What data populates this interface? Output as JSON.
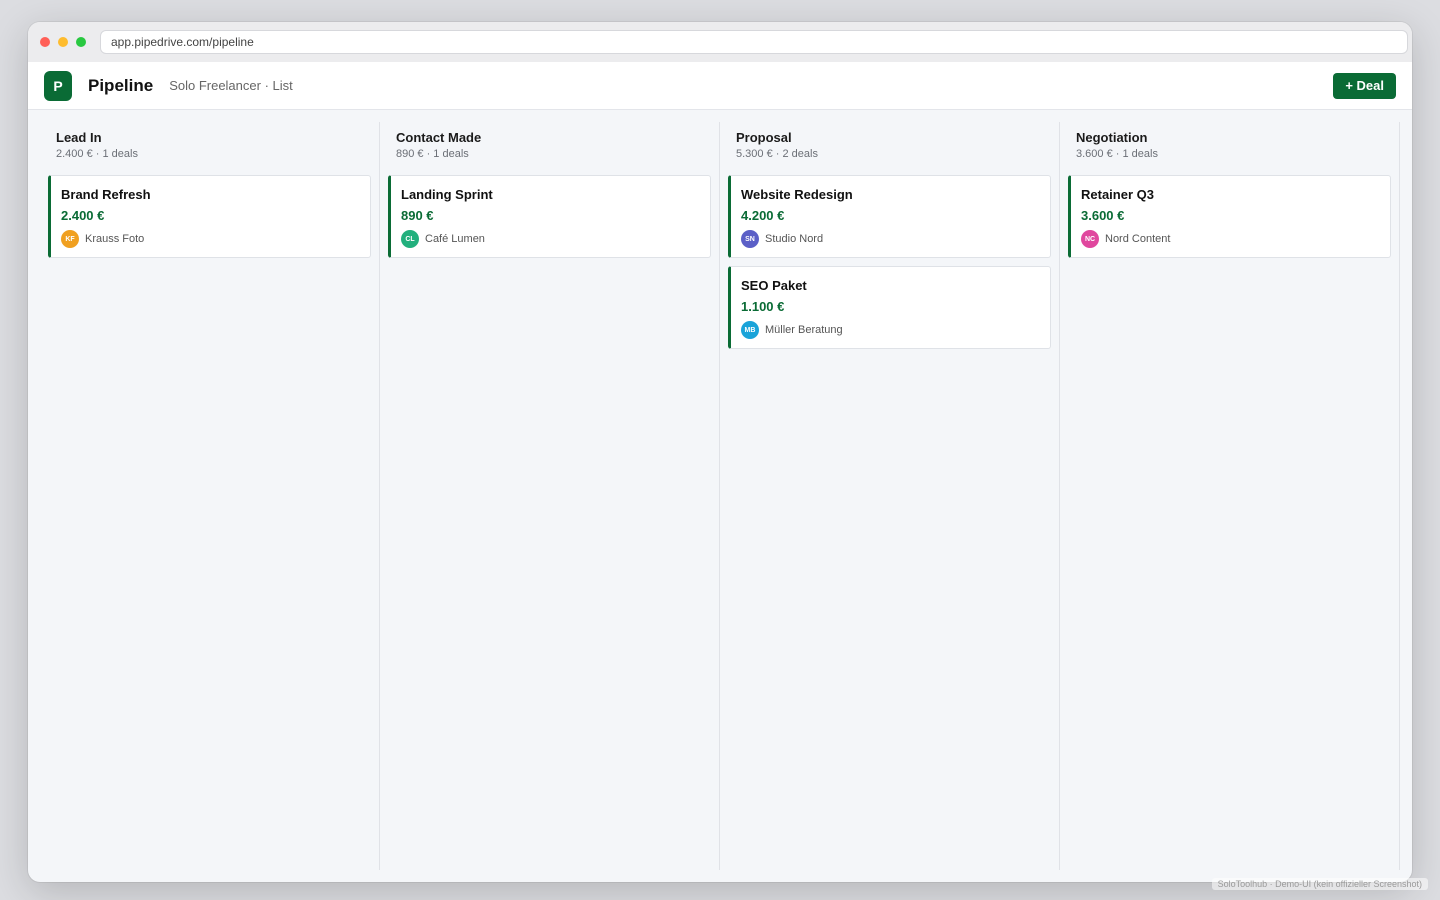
{
  "browser": {
    "url": "app.pipedrive.com/pipeline",
    "traffic_lights": [
      "#ff5f57",
      "#febc2e",
      "#28c840"
    ]
  },
  "header": {
    "logo_letter": "P",
    "title": "Pipeline",
    "subtitle": "Solo Freelancer · List",
    "new_deal_label": "+ Deal"
  },
  "colors": {
    "brand": "#0a6b35",
    "deal_value": "#0a6b35"
  },
  "stages": [
    {
      "name": "Lead In",
      "summary": "2.400 € · 1 deals",
      "deals": [
        {
          "title": "Brand Refresh",
          "value": "2.400 €",
          "org": "Krauss Foto",
          "initials": "KF",
          "avatar_color": "#f0a020"
        }
      ]
    },
    {
      "name": "Contact Made",
      "summary": "890 € · 1 deals",
      "deals": [
        {
          "title": "Landing Sprint",
          "value": "890 €",
          "org": "Café Lumen",
          "initials": "CL",
          "avatar_color": "#22b07d"
        }
      ]
    },
    {
      "name": "Proposal",
      "summary": "5.300 € · 2 deals",
      "deals": [
        {
          "title": "Website Redesign",
          "value": "4.200 €",
          "org": "Studio Nord",
          "initials": "SN",
          "avatar_color": "#5b5fc7"
        },
        {
          "title": "SEO Paket",
          "value": "1.100 €",
          "org": "Müller Beratung",
          "initials": "MB",
          "avatar_color": "#1aa3d9"
        }
      ]
    },
    {
      "name": "Negotiation",
      "summary": "3.600 € · 1 deals",
      "deals": [
        {
          "title": "Retainer Q3",
          "value": "3.600 €",
          "org": "Nord Content",
          "initials": "NC",
          "avatar_color": "#e0479e"
        }
      ]
    }
  ],
  "footer_note": "SoloToolhub · Demo-UI (kein offizieller Screenshot)"
}
